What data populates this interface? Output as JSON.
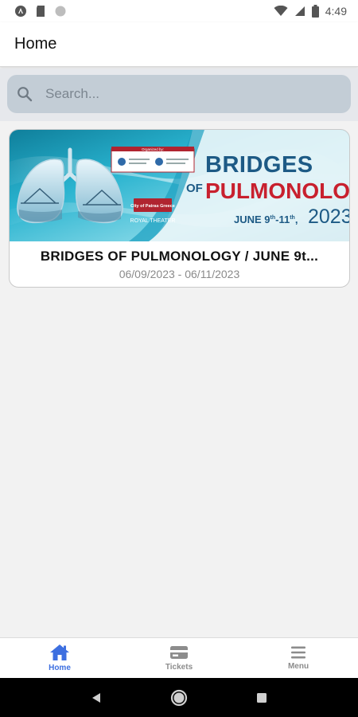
{
  "status_bar": {
    "time": "4:49"
  },
  "header": {
    "title": "Home"
  },
  "search": {
    "placeholder": "Search..."
  },
  "events": [
    {
      "title": "BRIDGES OF PULMONOLOGY / JUNE 9t...",
      "dates": "06/09/2023 - 06/11/2023",
      "banner": {
        "organized_by": "Organized by:",
        "headline_line1": "BRIDGES",
        "headline_of": "OF",
        "headline_line2": "PULMONOLOGY",
        "date_text": "JUNE 9",
        "date_sup1": "th",
        "date_mid": "-11",
        "date_sup2": "th",
        "date_comma": ",",
        "year": "2023",
        "venue_city": "City of Patras Greece",
        "venue_name": "ROYAL THEATER"
      }
    }
  ],
  "tabs": [
    {
      "label": "Home",
      "icon": "home-icon",
      "active": true
    },
    {
      "label": "Tickets",
      "icon": "ticket-icon",
      "active": false
    },
    {
      "label": "Menu",
      "icon": "menu-icon",
      "active": false
    }
  ],
  "colors": {
    "accent": "#3d6fe0",
    "banner_teal": "#1aa6c4",
    "headline_blue": "#1d5a85",
    "headline_red": "#c8202e"
  }
}
